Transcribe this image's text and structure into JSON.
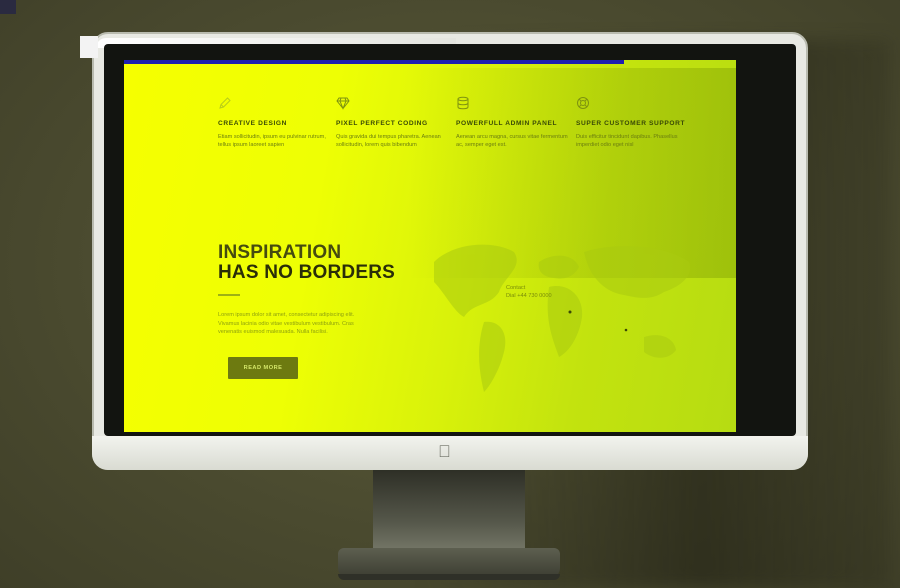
{
  "features": [
    {
      "icon": "pencil-icon",
      "title": "Creative Design",
      "text": "Etiam sollicitudin, ipsum eu pulvinar rutrum, tellus ipsum laoreet sapien"
    },
    {
      "icon": "diamond-icon",
      "title": "Pixel Perfect Coding",
      "text": "Quis gravida dui tempus pharetra. Aenean sollicitudin, lorem quis bibendum"
    },
    {
      "icon": "database-icon",
      "title": "Powerfull Admin Panel",
      "text": "Aenean arcu magna, cursus vitae fermentum ac, semper eget est."
    },
    {
      "icon": "lifebuoy-icon",
      "title": "Super Customer Support",
      "text": "Duis efficitur tincidunt dapibus. Phasellus imperdiet odio eget nisl"
    }
  ],
  "hero": {
    "headline_line1": "INSPIRATION",
    "headline_line2": "HAS NO BORDERS",
    "body": "Lorem ipsum dolor sit amet, consectetur adipiscing elit. Vivamus lacinia odio vitae vestibulum vestibulum. Cras venenatis euismod malesuada. Nulla facilisi.",
    "cta_label": "READ MORE"
  },
  "contact": {
    "label": "Contact",
    "phone": "Dial +44 730 0000"
  },
  "colors": {
    "screen_yellow": "#f6ff00",
    "screen_green": "#b6dc12",
    "top_bar_blue": "#1e1fb0",
    "cta_bg": "#6d7a10"
  }
}
